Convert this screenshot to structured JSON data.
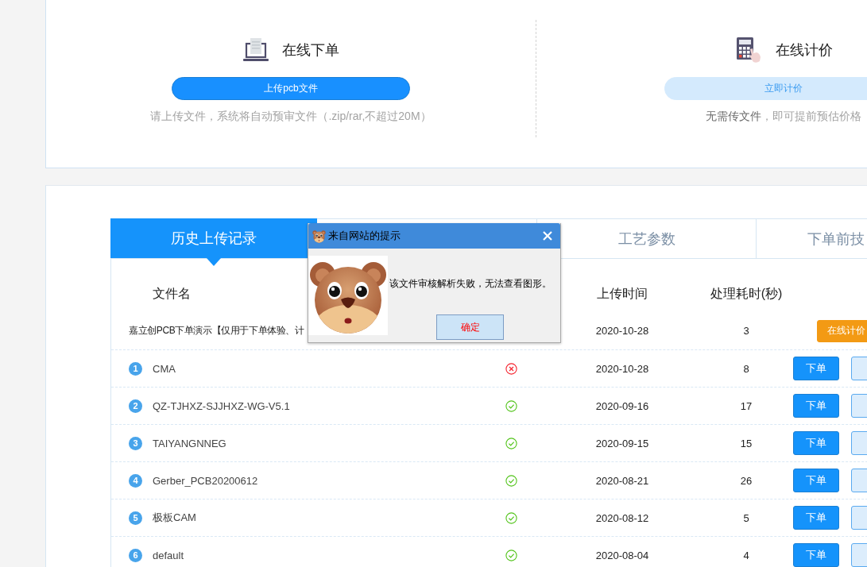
{
  "panels": [
    {
      "kind": "upload",
      "title": "在线下单",
      "button": "上传pcb文件",
      "hint": "请上传文件，系统将自动预审文件（.zip/rar,不超过20M）"
    },
    {
      "kind": "quote",
      "title": "在线计价",
      "button": "立即计价",
      "hint": "**无需传文件**，即可提前预估价格"
    }
  ],
  "tabs": [
    {
      "label": "历史上传记录",
      "selected": true
    },
    {
      "label": "工艺参数",
      "selected": false
    },
    {
      "label": "下单前技",
      "selected": false
    }
  ],
  "table": {
    "columns": {
      "file_name": "文件名",
      "upload_time": "上传时间",
      "processing_seconds": "处理耗时(秒)"
    },
    "rows": [
      {
        "kind": "demo",
        "name": "嘉立创PCB下单演示【仅用于下单体验、计",
        "upload_time": "2020-10-28",
        "processing_seconds": "3",
        "action": "在线计价"
      },
      {
        "kind": "file",
        "number": "1",
        "name": "CMA",
        "passed": false,
        "upload_time": "2020-10-28",
        "processing_seconds": "8",
        "action": "下单"
      },
      {
        "kind": "file",
        "number": "2",
        "name": "QZ-TJHXZ-SJJHXZ-WG-V5.1",
        "passed": true,
        "upload_time": "2020-09-16",
        "processing_seconds": "17",
        "action": "下单"
      },
      {
        "kind": "file",
        "number": "3",
        "name": "TAIYANGNNEG",
        "passed": true,
        "upload_time": "2020-09-15",
        "processing_seconds": "15",
        "action": "下单"
      },
      {
        "kind": "file",
        "number": "4",
        "name": "Gerber_PCB20200612",
        "passed": true,
        "upload_time": "2020-08-21",
        "processing_seconds": "26",
        "action": "下单"
      },
      {
        "kind": "file",
        "number": "5",
        "name": "极板CAM",
        "passed": true,
        "upload_time": "2020-08-12",
        "processing_seconds": "5",
        "action": "下单"
      },
      {
        "kind": "file",
        "number": "6",
        "name": "default",
        "passed": true,
        "upload_time": "2020-08-04",
        "processing_seconds": "4",
        "action": "下单"
      }
    ]
  },
  "dialog": {
    "title": "来自网站的提示",
    "message": "该文件审核解析失败，无法查看图形。",
    "button": "确定"
  }
}
